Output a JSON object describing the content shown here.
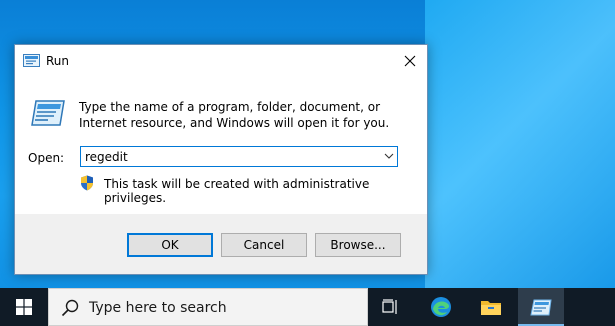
{
  "dialog": {
    "title": "Run",
    "title_icon": "run-icon",
    "close_icon": "close-icon",
    "description": "Type the name of a program, folder, document, or Internet resource, and Windows will open it for you.",
    "open_label": "Open:",
    "open_value": "regedit",
    "admin_note": "This task will be created with administrative privileges.",
    "buttons": {
      "ok": "OK",
      "cancel": "Cancel",
      "browse": "Browse..."
    },
    "accent_color": "#0078d7"
  },
  "taskbar": {
    "start_icon": "windows-logo-icon",
    "search_placeholder": "Type here to search",
    "items": [
      {
        "icon": "task-view-icon",
        "active": false
      },
      {
        "icon": "edge-icon",
        "active": false
      },
      {
        "icon": "file-explorer-icon",
        "active": false
      },
      {
        "icon": "run-icon",
        "active": true
      }
    ]
  }
}
